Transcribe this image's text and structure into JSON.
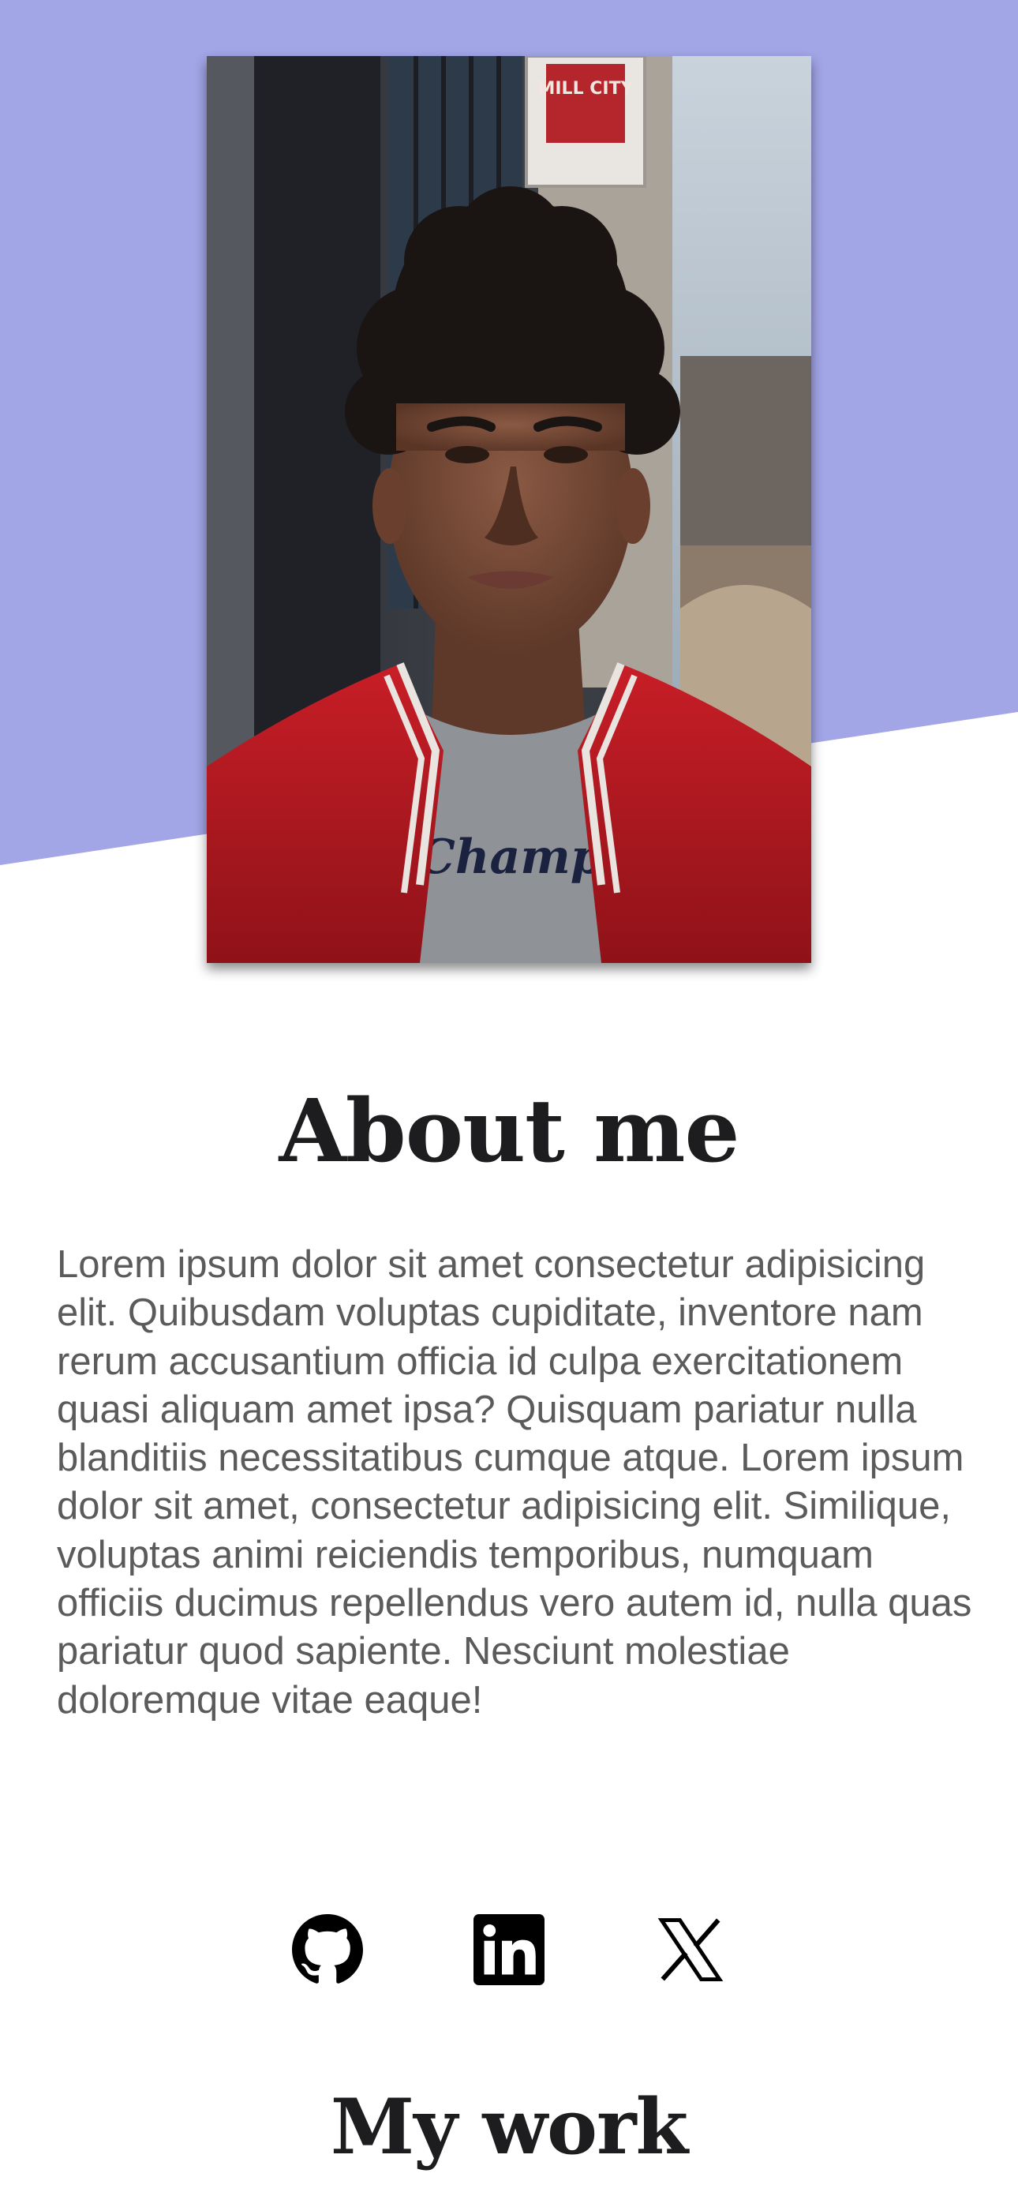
{
  "hero": {
    "accent_color": "#a2a5e6",
    "photo": {
      "subject": "young man with curly hair in red bomber jacket over grey t-shirt, city street background",
      "shirt_text": "Champ",
      "sign_text": "MILL CITY"
    }
  },
  "about": {
    "title": "About me",
    "body": "Lorem ipsum dolor sit amet consectetur adipisicing elit. Quibusdam voluptas cupiditate, inventore nam rerum accusantium officia id culpa exercitationem quasi aliquam amet ipsa? Quisquam pariatur nulla blanditiis necessitatibus cumque atque. Lorem ipsum dolor sit amet, consectetur adipisicing elit. Similique, voluptas animi reiciendis temporibus, numquam officiis ducimus repellendus vero autem id, nulla quas pariatur quod sapiente. Nesciunt molestiae doloremque vitae eaque!"
  },
  "social": [
    {
      "icon": "github-icon"
    },
    {
      "icon": "linkedin-icon"
    },
    {
      "icon": "x-icon"
    }
  ],
  "work": {
    "title": "My work"
  }
}
